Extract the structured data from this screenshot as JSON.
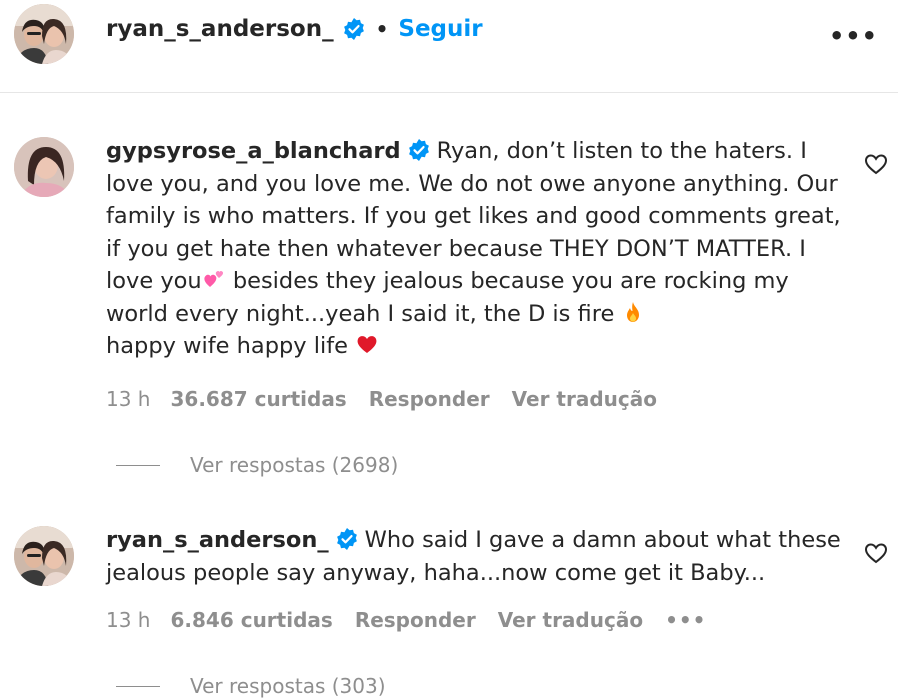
{
  "header": {
    "username": "ryan_s_anderson_",
    "separator": "•",
    "follow_label": "Seguir",
    "more_label": "•••"
  },
  "comments": [
    {
      "username": "gypsyrose_a_blanchard",
      "text_parts": [
        "Ryan, don’t listen to the haters. I love you, and you love me. We do not owe anyone anything. Our family is who matters. If you get likes and good comments great, if you get hate then whatever because THEY DON’T MATTER. I love you",
        "  besides they jealous because you are rocking my world every night...yeah I said it, the D is fire",
        " happy wife happy life "
      ],
      "emojis": [
        "two-hearts",
        "fire",
        "red-heart"
      ],
      "time": "13 h",
      "likes": "36.687 curtidas",
      "reply_label": "Responder",
      "translate_label": "Ver tradução",
      "view_replies": "Ver respostas (2698)"
    },
    {
      "username": "ryan_s_anderson_",
      "text": "Who said I gave a damn about what these jealous people say anyway, haha...now come get it Baby...",
      "time": "13 h",
      "likes": "6.846 curtidas",
      "reply_label": "Responder",
      "translate_label": "Ver tradução",
      "more_label": "•••",
      "view_replies": "Ver respostas (303)"
    }
  ],
  "colors": {
    "link_blue": "#0095f6",
    "verified_blue": "#0095f6",
    "meta_gray": "#8e8e8e",
    "text": "#262626"
  }
}
